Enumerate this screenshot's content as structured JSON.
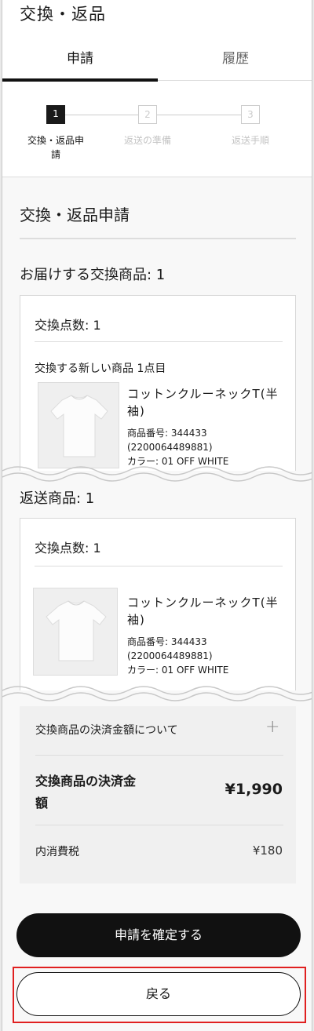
{
  "page": {
    "title": "交換・返品"
  },
  "tabs": [
    {
      "label": "申請",
      "active": true
    },
    {
      "label": "履歴",
      "active": false
    }
  ],
  "steps": [
    {
      "number": "1",
      "label_line1": "交換・返品申",
      "label_line2": "請",
      "active": true
    },
    {
      "number": "2",
      "label_line1": "返送の準備",
      "label_line2": "",
      "active": false
    },
    {
      "number": "3",
      "label_line1": "返送手順",
      "label_line2": "",
      "active": false
    }
  ],
  "main": {
    "section_title": "交換・返品申請",
    "delivery_title": "お届けする交換商品: 1",
    "exchange_card": {
      "count": "交換点数: 1",
      "subheading": "交換する新しい商品 1点目",
      "product": {
        "name_line1": "コットンクルーネックT(半",
        "name_line2": "袖)",
        "number_line1": "商品番号: 344433",
        "number_line2": "(2200064489881)",
        "color": "カラー: 01 OFF WHITE"
      }
    },
    "return_title": "返送商品: 1",
    "return_card": {
      "count": "交換点数: 1",
      "product": {
        "name_line1": "コットンクルーネックT(半",
        "name_line2": "袖)",
        "number_line1": "商品番号: 344433",
        "number_line2": "(2200064489881)",
        "color": "カラー: 01 OFF WHITE"
      }
    },
    "payment": {
      "about": "交換商品の決済金額について",
      "expand_icon": "plus-icon",
      "amount_label_line1": "交換商品の決済金",
      "amount_label_line2": "額",
      "amount": "¥1,990",
      "tax_label": "内消費税",
      "tax_amount": "¥180"
    }
  },
  "buttons": {
    "confirm": "申請を確定する",
    "back": "戻る"
  },
  "colors": {
    "primary": "#111111",
    "highlight": "#e02020",
    "inactive": "#cccccc"
  }
}
